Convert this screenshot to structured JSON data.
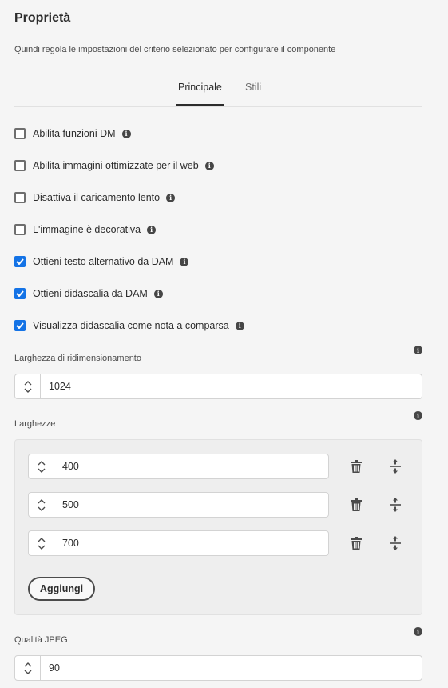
{
  "header": {
    "title": "Proprietà",
    "subtitle": "Quindi regola le impostazioni del criterio selezionato per configurare il componente"
  },
  "tabs": [
    {
      "label": "Principale",
      "active": true
    },
    {
      "label": "Stili",
      "active": false
    }
  ],
  "checkboxes": [
    {
      "label": "Abilita funzioni DM",
      "checked": false
    },
    {
      "label": "Abilita immagini ottimizzate per il web",
      "checked": false
    },
    {
      "label": "Disattiva il caricamento lento",
      "checked": false
    },
    {
      "label": "L'immagine è decorativa",
      "checked": false
    },
    {
      "label": "Ottieni testo alternativo da DAM",
      "checked": true
    },
    {
      "label": "Ottieni didascalia da DAM",
      "checked": true
    },
    {
      "label": "Visualizza didascalia come nota a comparsa",
      "checked": true
    }
  ],
  "resize_width": {
    "label": "Larghezza di ridimensionamento",
    "value": "1024"
  },
  "widths": {
    "label": "Larghezze",
    "items": [
      "400",
      "500",
      "700"
    ],
    "add_label": "Aggiungi"
  },
  "jpeg_quality": {
    "label": "Qualità JPEG",
    "value": "90"
  },
  "icons": {
    "info": "info-icon",
    "stepper": "stepper-icon",
    "delete": "trash-icon",
    "reorder": "reorder-icon",
    "check": "checkmark-icon"
  },
  "colors": {
    "accent": "#1473e6",
    "background": "#f5f5f5"
  }
}
